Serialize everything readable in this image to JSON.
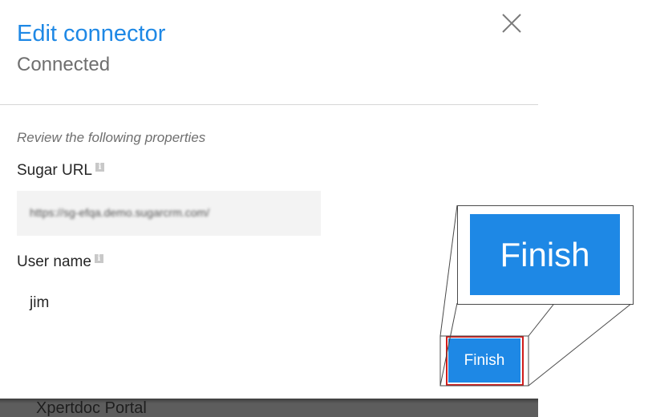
{
  "dialog": {
    "title": "Edit connector",
    "subtitle": "Connected",
    "instructions": "Review the following properties",
    "fields": {
      "sugar_url": {
        "label": "Sugar URL",
        "value": "https://sg-efqa.demo.sugarcrm.com/"
      },
      "user_name": {
        "label": "User name",
        "value": "jim"
      }
    },
    "finish_label": "Finish"
  },
  "zoom": {
    "finish_label": "Finish"
  },
  "background_page": {
    "app_name": "Xpertdoc Portal"
  },
  "icons": {
    "close": "close-icon",
    "info": "info-icon"
  },
  "colors": {
    "accent": "#1e88e5",
    "highlight": "#d01c1c"
  }
}
